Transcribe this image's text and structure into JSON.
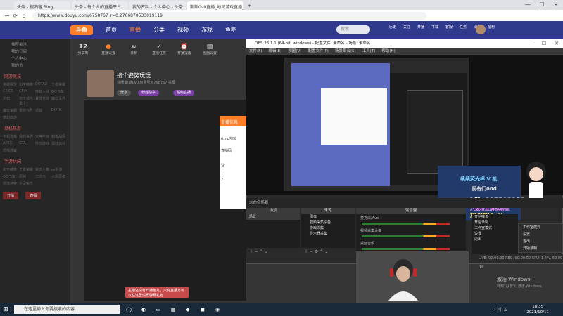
{
  "browser": {
    "tabs": [
      {
        "label": "头条 - 搜内容 Bing"
      },
      {
        "label": "头条 - 每个人的直播平台"
      },
      {
        "label": "我的资料 - 个人中心 - 头条"
      },
      {
        "label": "斯斯0v0直播_地域游戏直播_斗鱼"
      }
    ],
    "url": "https://www.douyu.com/6758767_r=0.2766870533019119",
    "new_tab": "+",
    "win_min": "—",
    "win_max": "☐",
    "win_close": "✕"
  },
  "site": {
    "logo": "斗鱼",
    "nav": [
      "首页",
      "直播",
      "分类",
      "视频",
      "游戏",
      "鱼吧"
    ],
    "search_placeholder": "搜索",
    "top_icons": [
      "历史",
      "关注",
      "开播",
      "下载",
      "客服",
      "任务",
      "消息",
      "福利"
    ]
  },
  "sidebar": {
    "items": [
      "推荐关注",
      "我的订阅",
      "个人中心",
      "我的鱼"
    ],
    "section1": "网游竞技",
    "grid1": [
      "英雄联盟",
      "和平精英",
      "DOTA2",
      "王者荣耀",
      "CF/CS",
      "CF/M",
      "穿越火线",
      "QQ飞车",
      "炉石",
      "地下城与勇士",
      "暴雪竞技",
      "魔兽世界",
      "魔兽争霸",
      "重燃代号",
      "逆战",
      "DOTA",
      "梦幻西游"
    ],
    "section2": "单机热游",
    "grid2": [
      "主机游戏",
      "我的世界",
      "方舟生存",
      "刺激战场",
      "APEX",
      "GTA",
      "怀旧游戏",
      "蛋仔派对",
      "恐怖游戏"
    ],
    "section3": "手游休闲",
    "grid3": [
      "和平精英",
      "王者荣耀",
      "第五人格",
      "cs手游",
      "QQ飞车",
      "原神",
      "二次元",
      "火影忍者",
      "部落冲突",
      "全民突击"
    ],
    "btn_left": "开播",
    "btn_right": "直播"
  },
  "stats": [
    {
      "value": "12",
      "label": "分享到"
    },
    {
      "value": "●",
      "label": "直播设置"
    },
    {
      "value": "≈",
      "label": "录制"
    },
    {
      "value": "✓",
      "label": "直播任务"
    },
    {
      "value": "⏰",
      "label": "开播提醒"
    },
    {
      "value": "▤",
      "label": "画面设置"
    }
  ],
  "room": {
    "title": "接个姿势玩玩",
    "meta": "直播   斯斯0v0   房间号:6758767   举报",
    "pill1": "分享",
    "pill2": "粉丝勋章",
    "pill3": "超级直播"
  },
  "popup": {
    "header": "直播信息",
    "lines": [
      "rtmp地址",
      "直播码",
      "注:",
      "1.",
      "2."
    ]
  },
  "gift_notice": "主播还没有开通鱼丸，只有直播方可以在这里设置弹幕礼物",
  "obs": {
    "title": "OBS 26.1.1 (64-bit, windows) - 配置文件: 未命名 - 场景: 未命名",
    "menu": [
      "文件(F)",
      "编辑(E)",
      "视图(V)",
      "配置文件(P)",
      "场景集合(S)",
      "工具(T)",
      "帮助(H)"
    ],
    "chat": {
      "l1": "续续荧光棒 V 机",
      "l2": "前有们ond",
      "l3": "Q群: 817502153",
      "l4": "八级粉丝牌私聊宣",
      "l5": "加VX群(^_^)"
    },
    "context_menu": [
      "工作室模式",
      "设置",
      "退出",
      "开始录制"
    ],
    "scenes_header": "场景",
    "scenes": [
      "场景"
    ],
    "sources_header": "来源",
    "sources": [
      "图像",
      "视频采集设备",
      "游戏采集",
      "显示器采集"
    ],
    "mixer_header": "混音器",
    "mixer": [
      "麦克风/Aux",
      "视频采集设备",
      "桌面音频"
    ],
    "scene_transitions": "场景转换",
    "controls": [
      "开始推流",
      "开始录制",
      "工作室模式",
      "设置",
      "退出"
    ],
    "no_scene": "未命名场景",
    "status": "LIVE: 00:00:00   REC: 00:00:00   CPU: 1.4%, 60.00 fps"
  },
  "watermark": {
    "l1": "激活 Windows",
    "l2": "转到\"设置\"以激活 Windows。"
  },
  "taskbar": {
    "search": "在这里输入你要搜索的内容",
    "time": "18:35",
    "date": "2021/10/11",
    "tray": "ㅅ 中 ⌂"
  },
  "colors": {
    "nav_bg": "#2f3a8c",
    "accent": "#ff7e28",
    "chat_bg": "#213a6a"
  }
}
